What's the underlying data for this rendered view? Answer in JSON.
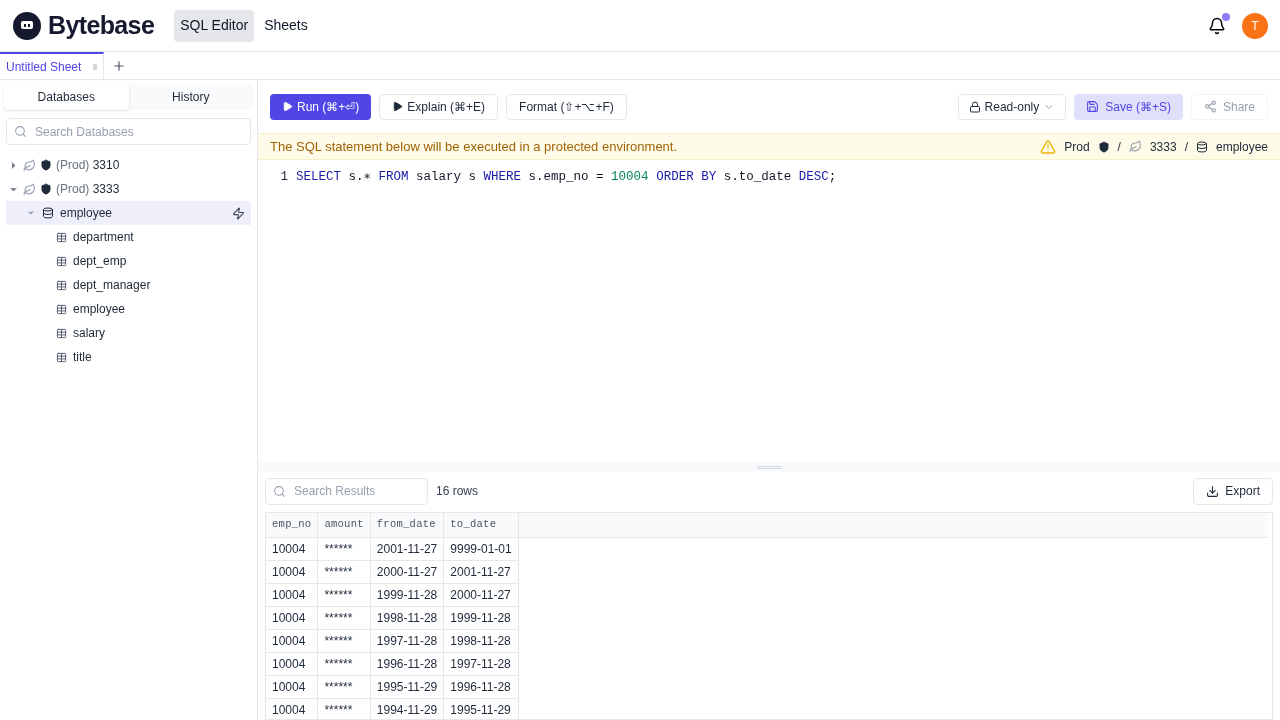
{
  "header": {
    "logo": "Bytebase",
    "nav": [
      {
        "label": "SQL Editor",
        "selected": true
      },
      {
        "label": "Sheets",
        "selected": false
      }
    ],
    "notification_dot": true,
    "avatar": "T"
  },
  "sheet_tabs": [
    {
      "label": "Untitled Sheet",
      "selected": true
    }
  ],
  "sidebar": {
    "tabs": [
      {
        "label": "Databases",
        "selected": true
      },
      {
        "label": "History",
        "selected": false
      }
    ],
    "search": {
      "placeholder": "Search Databases"
    },
    "tree": [
      {
        "env": "(Prod)",
        "name": "3310",
        "expanded": false
      },
      {
        "env": "(Prod)",
        "name": "3333",
        "expanded": true,
        "children": [
          {
            "name": "employee",
            "expanded": true,
            "selected": true,
            "children": [
              {
                "name": "department"
              },
              {
                "name": "dept_emp"
              },
              {
                "name": "dept_manager"
              },
              {
                "name": "employee"
              },
              {
                "name": "salary"
              },
              {
                "name": "title"
              }
            ]
          }
        ]
      }
    ]
  },
  "toolbar": {
    "run": "Run (⌘+⏎)",
    "explain": "Explain (⌘+E)",
    "format": "Format (⇧+⌥+F)",
    "mode": "Read-only",
    "save": "Save (⌘+S)",
    "share": "Share",
    "share_disabled": true
  },
  "banner": {
    "message": "The SQL statement below will be executed in a protected environment.",
    "environment": "Prod",
    "separator": "/",
    "instance": "3333",
    "database": "employee"
  },
  "editor": {
    "lines": [
      {
        "number": "1",
        "tokens": [
          {
            "kind": "keyword",
            "text": "SELECT"
          },
          {
            "kind": "plain",
            "text": " s.∗ "
          },
          {
            "kind": "keyword",
            "text": "FROM"
          },
          {
            "kind": "plain",
            "text": " salary s "
          },
          {
            "kind": "keyword",
            "text": "WHERE"
          },
          {
            "kind": "plain",
            "text": " s.emp_no = "
          },
          {
            "kind": "number",
            "text": "10004"
          },
          {
            "kind": "keyword",
            "text": " ORDER BY"
          },
          {
            "kind": "plain",
            "text": " s.to_date "
          },
          {
            "kind": "keyword",
            "text": "DESC"
          },
          {
            "kind": "plain",
            "text": ";"
          }
        ]
      }
    ]
  },
  "results": {
    "search": {
      "placeholder": "Search Results"
    },
    "count": "16 rows",
    "export": "Export",
    "columns": [
      "emp_no",
      "amount",
      "from_date",
      "to_date"
    ],
    "rows": [
      [
        "10004",
        "******",
        "2001-11-27",
        "9999-01-01"
      ],
      [
        "10004",
        "******",
        "2000-11-27",
        "2001-11-27"
      ],
      [
        "10004",
        "******",
        "1999-11-28",
        "2000-11-27"
      ],
      [
        "10004",
        "******",
        "1998-11-28",
        "1999-11-28"
      ],
      [
        "10004",
        "******",
        "1997-11-28",
        "1998-11-28"
      ],
      [
        "10004",
        "******",
        "1996-11-28",
        "1997-11-28"
      ],
      [
        "10004",
        "******",
        "1995-11-29",
        "1996-11-28"
      ],
      [
        "10004",
        "******",
        "1994-11-29",
        "1995-11-29"
      ]
    ]
  }
}
